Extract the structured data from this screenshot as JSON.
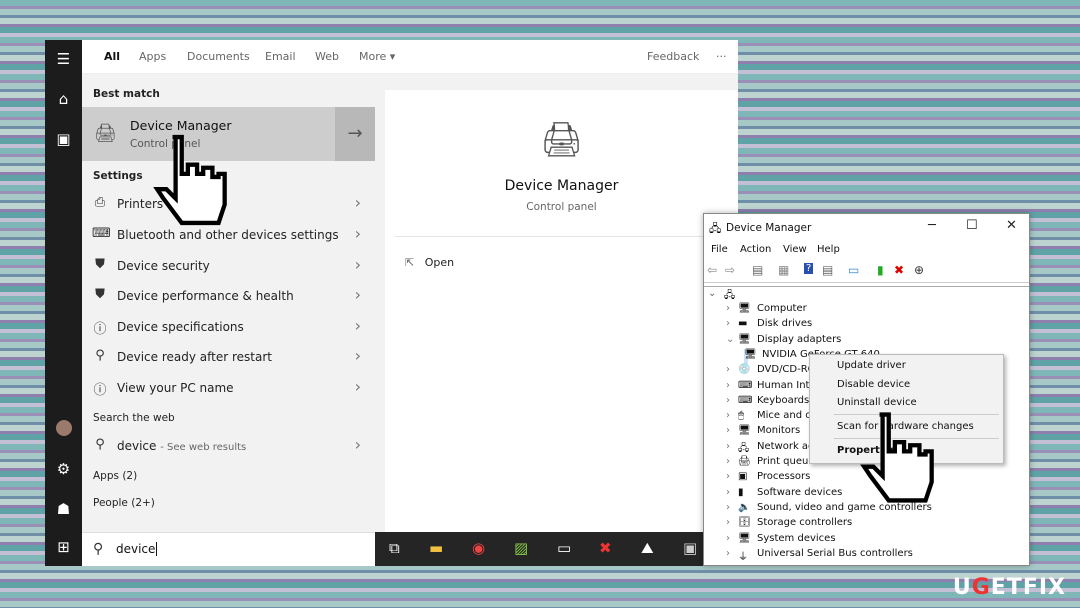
{
  "search_panel": {
    "tabs": [
      "All",
      "Apps",
      "Documents",
      "Email",
      "Web",
      "More"
    ],
    "feedback": "Feedback",
    "more_options": "···",
    "best_match_header": "Best match",
    "best_match": {
      "title": "Device Manager",
      "subtitle": "Control panel"
    },
    "settings_header": "Settings",
    "settings_items": [
      {
        "label": "Printers &",
        "icon": "printer-icon"
      },
      {
        "label": "Bluetooth and other devices settings",
        "icon": "bluetooth-devices-icon"
      },
      {
        "label": "Device security",
        "icon": "shield-icon"
      },
      {
        "label": "Device performance & health",
        "icon": "shield-icon"
      },
      {
        "label": "Device specifications",
        "icon": "info-icon"
      },
      {
        "label": "Device ready after restart",
        "icon": "search-gear-icon"
      },
      {
        "label": "View your PC name",
        "icon": "info-icon"
      }
    ],
    "web_header": "Search the web",
    "web_item": {
      "query": "device",
      "suffix": "- See web results"
    },
    "apps_header": "Apps (2)",
    "people_header": "People (2+)",
    "search_value": "device",
    "preview": {
      "title": "Device Manager",
      "subtitle": "Control panel",
      "open_label": "Open"
    }
  },
  "device_manager": {
    "title": "Device Manager",
    "menu": [
      "File",
      "Action",
      "View",
      "Help"
    ],
    "tree": [
      {
        "label": "Computer",
        "expanded": false
      },
      {
        "label": "Disk drives",
        "expanded": false
      },
      {
        "label": "Display adapters",
        "expanded": true
      },
      {
        "label": "NVIDIA GeForce GT 640",
        "child": true
      },
      {
        "label": "DVD/CD-RO",
        "expanded": false
      },
      {
        "label": "Human Inte",
        "expanded": false
      },
      {
        "label": "Keyboards",
        "expanded": false
      },
      {
        "label": "Mice and ot",
        "expanded": false
      },
      {
        "label": "Monitors",
        "expanded": false
      },
      {
        "label": "Network ad",
        "expanded": false
      },
      {
        "label": "Print queue",
        "expanded": false
      },
      {
        "label": "Processors",
        "expanded": false
      },
      {
        "label": "Software devices",
        "expanded": false
      },
      {
        "label": "Sound, video and game controllers",
        "expanded": false
      },
      {
        "label": "Storage controllers",
        "expanded": false
      },
      {
        "label": "System devices",
        "expanded": false
      },
      {
        "label": "Universal Serial Bus controllers",
        "expanded": false
      }
    ],
    "context_menu": [
      "Update driver",
      "Disable device",
      "Uninstall device",
      "Scan for hardware changes",
      "Properties"
    ]
  },
  "watermark": "UGETFIX"
}
